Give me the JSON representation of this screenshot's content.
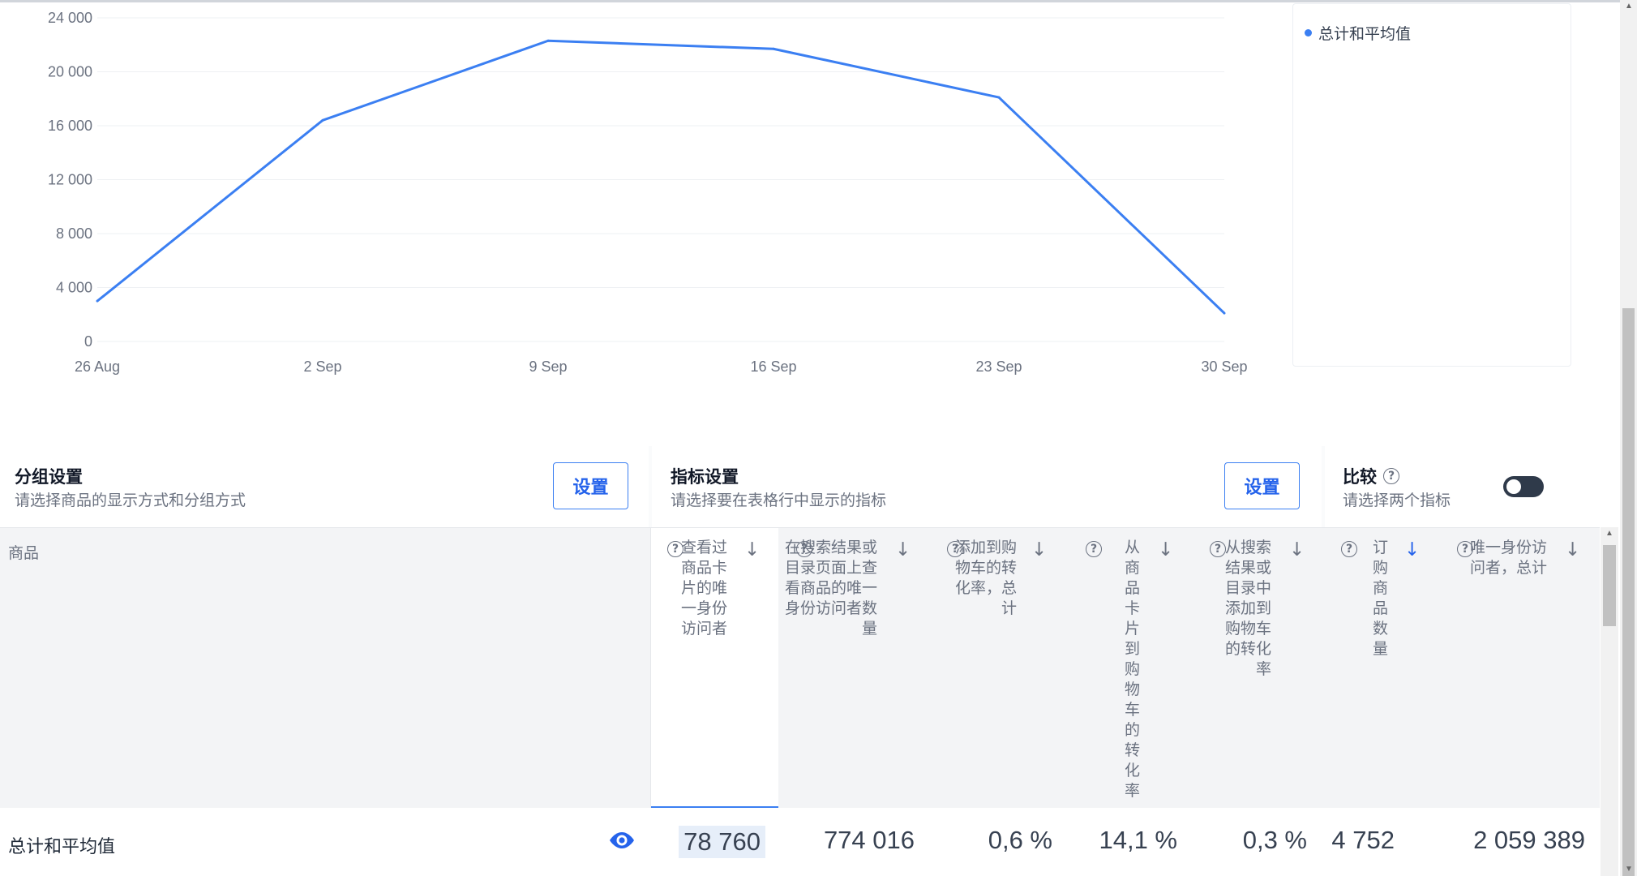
{
  "chart_data": {
    "type": "line",
    "x": [
      "26 Aug",
      "2 Sep",
      "9 Sep",
      "16 Sep",
      "23 Sep",
      "30 Sep"
    ],
    "series": [
      {
        "name": "总计和平均值",
        "color": "#3b7ff2",
        "values": [
          3000,
          16400,
          22300,
          21700,
          18100,
          2100
        ]
      }
    ],
    "yticks": [
      "24 000",
      "20 000",
      "16 000",
      "12 000",
      "8 000",
      "4 000",
      "0"
    ],
    "ylim": [
      0,
      24000
    ],
    "grid": true,
    "legend": "right"
  },
  "legend": {
    "label": "总计和平均值"
  },
  "grouping": {
    "title": "分组设置",
    "subtitle": "请选择商品的显示方式和分组方式",
    "button": "设置"
  },
  "metrics_settings": {
    "title": "指标设置",
    "subtitle": "请选择要在表格行中显示的指标",
    "button": "设置"
  },
  "compare": {
    "title": "比较",
    "subtitle": "请选择两个指标",
    "help": "?"
  },
  "table": {
    "product_header": "商品",
    "columns": [
      {
        "label": "查看过商品卡片的唯一身份访问者",
        "sort": "↓"
      },
      {
        "label": "在搜索结果或目录页面上查看商品的唯一身份访问者数量",
        "sort": "↓"
      },
      {
        "label": "添加到购物车的转化率，总计",
        "sort": "↓"
      },
      {
        "label": "从商品卡片到购物车的转化率",
        "sort": "↓"
      },
      {
        "label": "从搜索结果或目录中添加到购物车的转化率",
        "sort": "↓"
      },
      {
        "label": "订购商品数量",
        "sort": "↓"
      },
      {
        "label": "唯一身份访问者，总计",
        "sort": "↓"
      }
    ],
    "total_row": {
      "label": "总计和平均值",
      "values": [
        "78 760",
        "774 016",
        "0,6 %",
        "14,1 %",
        "0,3 %",
        "4 752",
        "2 059 389"
      ]
    }
  }
}
